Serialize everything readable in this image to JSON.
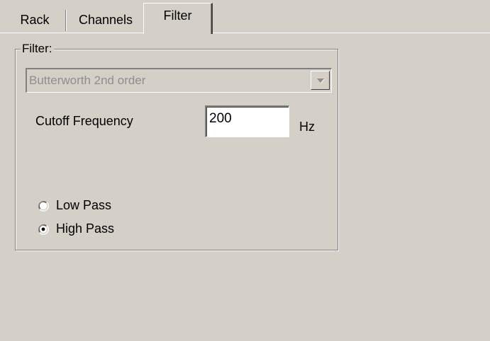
{
  "tabs": [
    {
      "label": "Rack",
      "active": false
    },
    {
      "label": "Channels",
      "active": false
    },
    {
      "label": "Filter",
      "active": true
    }
  ],
  "filter_group": {
    "legend": "Filter:",
    "filter_type": {
      "selected": "Butterworth 2nd order",
      "enabled": false
    },
    "cutoff": {
      "label": "Cutoff Frequency",
      "value": "200",
      "unit": "Hz"
    },
    "pass_mode": {
      "options": [
        {
          "label": "Low Pass",
          "checked": false
        },
        {
          "label": "High Pass",
          "checked": true
        }
      ]
    }
  },
  "colors": {
    "face": "#d4d0c8",
    "shadow": "#808080",
    "highlight": "#ffffff",
    "disabled_text": "#8e8e8e"
  }
}
